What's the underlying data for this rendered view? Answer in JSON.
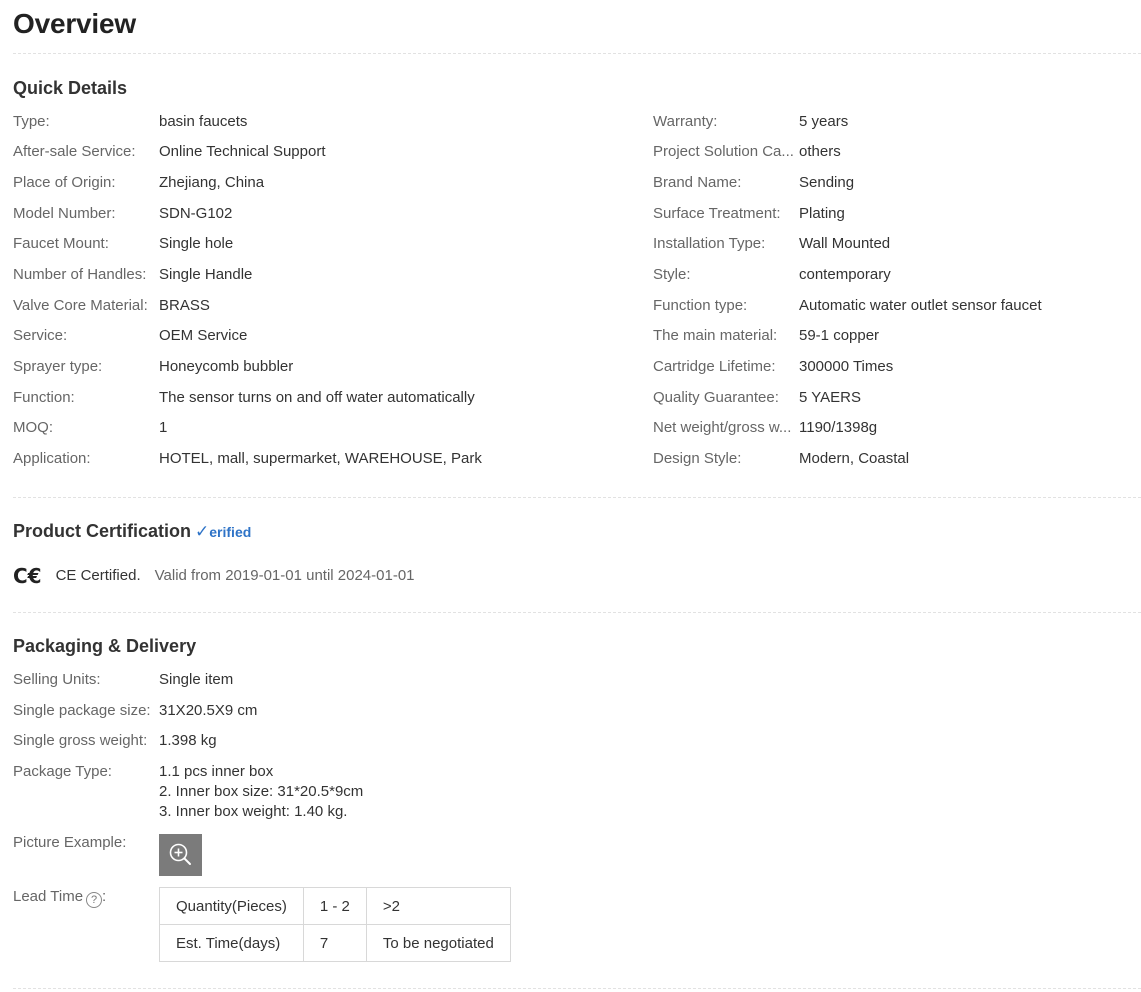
{
  "page": {
    "title": "Overview"
  },
  "quick_details": {
    "heading": "Quick Details",
    "left": [
      {
        "label": "Type:",
        "value": "basin faucets"
      },
      {
        "label": "After-sale Service:",
        "value": "Online Technical Support"
      },
      {
        "label": "Place of Origin:",
        "value": "Zhejiang, China"
      },
      {
        "label": "Model Number:",
        "value": "SDN-G102"
      },
      {
        "label": "Faucet Mount:",
        "value": "Single hole"
      },
      {
        "label": "Number of Handles:",
        "value": "Single Handle"
      },
      {
        "label": "Valve Core Material:",
        "value": "BRASS"
      },
      {
        "label": "Service:",
        "value": "OEM Service"
      },
      {
        "label": "Sprayer type:",
        "value": "Honeycomb bubbler"
      },
      {
        "label": "Function:",
        "value": "The sensor turns on and off water automatically"
      },
      {
        "label": "MOQ:",
        "value": "1"
      },
      {
        "label": "Application:",
        "value": "HOTEL, mall, supermarket, WAREHOUSE, Park"
      }
    ],
    "right": [
      {
        "label": "Warranty:",
        "value": "5 years"
      },
      {
        "label": "Project Solution Ca...",
        "value": "others"
      },
      {
        "label": "Brand Name:",
        "value": "Sending"
      },
      {
        "label": "Surface Treatment:",
        "value": "Plating"
      },
      {
        "label": "Installation Type:",
        "value": "Wall Mounted"
      },
      {
        "label": "Style:",
        "value": "contemporary"
      },
      {
        "label": "Function type:",
        "value": "Automatic water outlet sensor faucet"
      },
      {
        "label": "The main material:",
        "value": "59-1 copper"
      },
      {
        "label": "Cartridge Lifetime:",
        "value": "300000 Times"
      },
      {
        "label": "Quality Guarantee:",
        "value": "5 YAERS"
      },
      {
        "label": "Net weight/gross w...",
        "value": "1190/1398g"
      },
      {
        "label": "Design Style:",
        "value": "Modern, Coastal"
      }
    ]
  },
  "certification": {
    "heading": "Product Certification",
    "verified_check": "✓",
    "verified_text": "erified",
    "mark": "C€",
    "name": "CE Certified.",
    "validity": "Valid from 2019-01-01 until 2024-01-01"
  },
  "packaging": {
    "heading": "Packaging & Delivery",
    "selling_units": {
      "label": "Selling Units:",
      "value": "Single item"
    },
    "package_size": {
      "label": "Single package size:",
      "value": "31X20.5X9 cm"
    },
    "gross_weight": {
      "label": "Single gross weight:",
      "value": "1.398 kg"
    },
    "package_type": {
      "label": "Package Type:",
      "lines": [
        "1.1 pcs inner box",
        "2. Inner box size: 31*20.5*9cm",
        "3. Inner box weight: 1.40 kg."
      ]
    },
    "picture": {
      "label": "Picture Example:",
      "icon": "zoom-in-icon"
    },
    "lead_time": {
      "label": "Lead Time",
      "help": "?",
      "colon": ":",
      "table": [
        [
          "Quantity(Pieces)",
          "1 - 2",
          ">2"
        ],
        [
          "Est. Time(days)",
          "7",
          "To be negotiated"
        ]
      ]
    }
  }
}
